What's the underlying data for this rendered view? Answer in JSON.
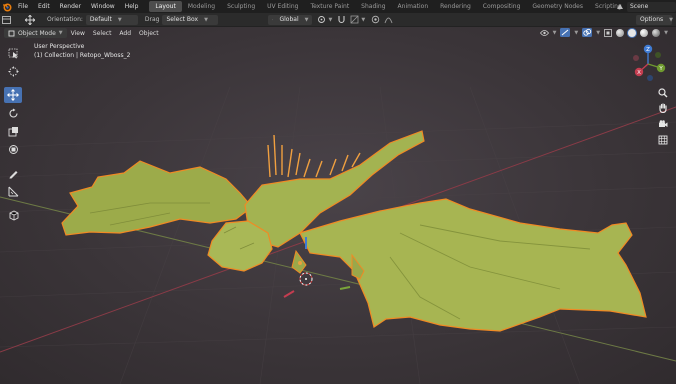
{
  "menubar": {
    "items": [
      "File",
      "Edit",
      "Render",
      "Window",
      "Help"
    ],
    "workspaces": [
      "Layout",
      "Modeling",
      "Sculpting",
      "UV Editing",
      "Texture Paint",
      "Shading",
      "Animation",
      "Rendering",
      "Compositing",
      "Geometry Nodes",
      "Scripting"
    ],
    "active_workspace": "Layout",
    "add_tab": "+",
    "scene": "Scene"
  },
  "toolheader": {
    "orientation_label": "Orientation:",
    "orientation_value": "Default",
    "drag_label": "Drag",
    "drag_value": "Select Box",
    "transform_space": "Global",
    "options": "Options"
  },
  "viewport_header": {
    "mode": "Object Mode",
    "menus": [
      "View",
      "Select",
      "Add",
      "Object"
    ]
  },
  "overlay": {
    "view_name": "User Perspective",
    "collection_info": "(1) Collection | Retopo_Wboss_2"
  },
  "gizmo": {
    "x": "X",
    "y": "Y",
    "z": "Z"
  },
  "colors": {
    "accent": "#4772b3",
    "selection_outline": "#f08a24",
    "object": "#a7b552"
  }
}
